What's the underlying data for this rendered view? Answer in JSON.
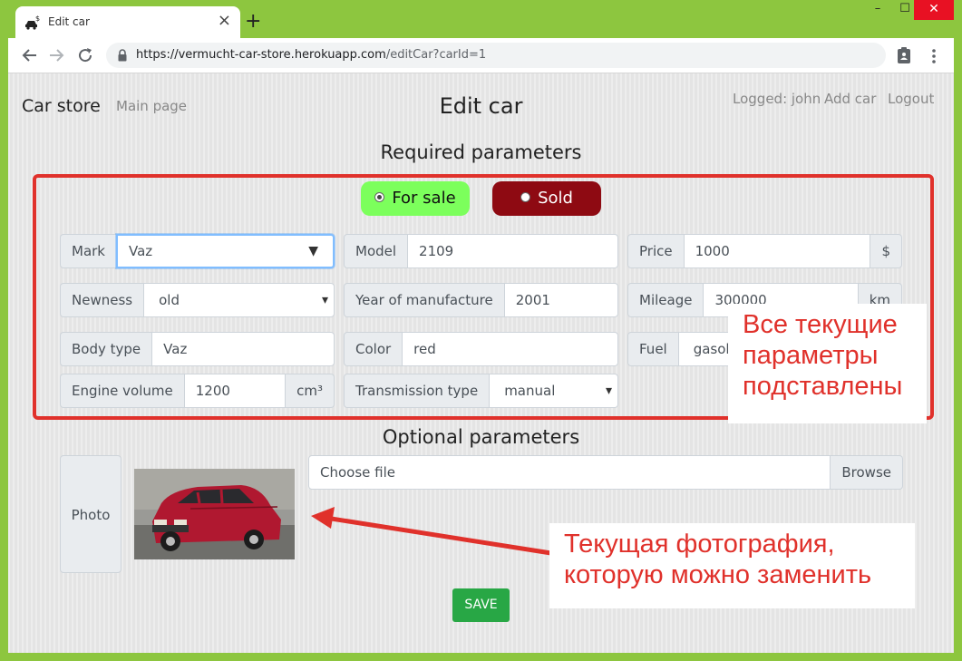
{
  "browser": {
    "tab_title": "Edit car",
    "new_tab": "+",
    "url_host": "https://vermucht-car-store.herokuapp.com",
    "url_path": "/editCar?carId=1",
    "win_min": "–",
    "win_max": "☐",
    "win_close": "✕",
    "tab_close": "×"
  },
  "nav": {
    "brand": "Car store",
    "main_page": "Main page",
    "logged": "Logged: john",
    "add_car": "Add car",
    "logout": "Logout"
  },
  "page": {
    "title": "Edit car",
    "required_title": "Required parameters",
    "optional_title": "Optional parameters"
  },
  "status": {
    "for_sale": "For sale",
    "sold": "Sold",
    "selected": "For sale"
  },
  "fields": {
    "mark": {
      "label": "Mark",
      "value": "Vaz"
    },
    "model": {
      "label": "Model",
      "value": "2109"
    },
    "price": {
      "label": "Price",
      "value": "1000",
      "unit": "$"
    },
    "newness": {
      "label": "Newness",
      "value": "old"
    },
    "year": {
      "label": "Year of manufacture",
      "value": "2001"
    },
    "mileage": {
      "label": "Mileage",
      "value": "300000",
      "unit": "km"
    },
    "body_type": {
      "label": "Body type",
      "value": "Vaz"
    },
    "color": {
      "label": "Color",
      "value": "red"
    },
    "fuel": {
      "label": "Fuel",
      "value": "gasoline"
    },
    "engine": {
      "label": "Engine volume",
      "value": "1200",
      "unit": "cm³"
    },
    "transmission": {
      "label": "Transmission type",
      "value": "manual"
    }
  },
  "optional": {
    "photo_label": "Photo",
    "file_placeholder": "Choose file",
    "browse": "Browse"
  },
  "save_label": "SAVE",
  "annotations": {
    "params": [
      "Все текущие",
      "параметры",
      "подставлены"
    ],
    "photo": [
      "Текущая фотография,",
      "которую можно заменить"
    ]
  },
  "colors": {
    "frame_green": "#8dc63f",
    "annotation_red": "#e0312b",
    "for_sale_green": "#7cff5c",
    "sold_red": "#8e0a12",
    "save_green": "#28a745",
    "car_red": "#b01830"
  }
}
